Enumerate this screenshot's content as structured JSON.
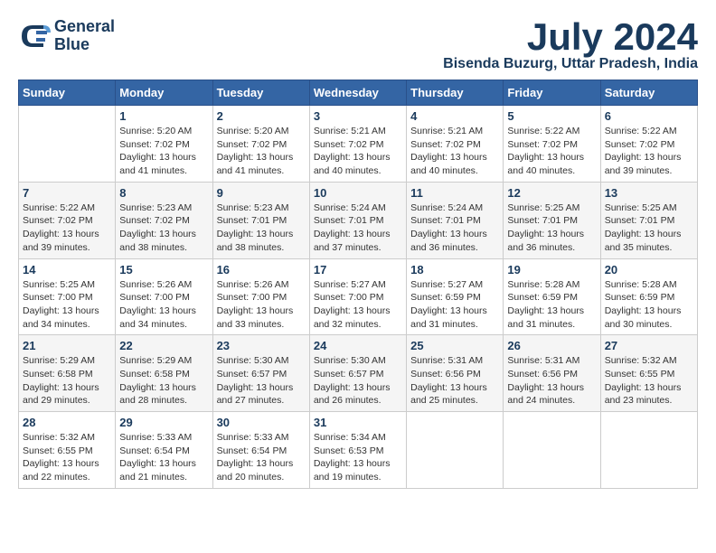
{
  "logo": {
    "line1": "General",
    "line2": "Blue"
  },
  "title": "July 2024",
  "location": "Bisenda Buzurg, Uttar Pradesh, India",
  "weekdays": [
    "Sunday",
    "Monday",
    "Tuesday",
    "Wednesday",
    "Thursday",
    "Friday",
    "Saturday"
  ],
  "weeks": [
    [
      {
        "day": "",
        "info": ""
      },
      {
        "day": "1",
        "info": "Sunrise: 5:20 AM\nSunset: 7:02 PM\nDaylight: 13 hours\nand 41 minutes."
      },
      {
        "day": "2",
        "info": "Sunrise: 5:20 AM\nSunset: 7:02 PM\nDaylight: 13 hours\nand 41 minutes."
      },
      {
        "day": "3",
        "info": "Sunrise: 5:21 AM\nSunset: 7:02 PM\nDaylight: 13 hours\nand 40 minutes."
      },
      {
        "day": "4",
        "info": "Sunrise: 5:21 AM\nSunset: 7:02 PM\nDaylight: 13 hours\nand 40 minutes."
      },
      {
        "day": "5",
        "info": "Sunrise: 5:22 AM\nSunset: 7:02 PM\nDaylight: 13 hours\nand 40 minutes."
      },
      {
        "day": "6",
        "info": "Sunrise: 5:22 AM\nSunset: 7:02 PM\nDaylight: 13 hours\nand 39 minutes."
      }
    ],
    [
      {
        "day": "7",
        "info": "Sunrise: 5:22 AM\nSunset: 7:02 PM\nDaylight: 13 hours\nand 39 minutes."
      },
      {
        "day": "8",
        "info": "Sunrise: 5:23 AM\nSunset: 7:02 PM\nDaylight: 13 hours\nand 38 minutes."
      },
      {
        "day": "9",
        "info": "Sunrise: 5:23 AM\nSunset: 7:01 PM\nDaylight: 13 hours\nand 38 minutes."
      },
      {
        "day": "10",
        "info": "Sunrise: 5:24 AM\nSunset: 7:01 PM\nDaylight: 13 hours\nand 37 minutes."
      },
      {
        "day": "11",
        "info": "Sunrise: 5:24 AM\nSunset: 7:01 PM\nDaylight: 13 hours\nand 36 minutes."
      },
      {
        "day": "12",
        "info": "Sunrise: 5:25 AM\nSunset: 7:01 PM\nDaylight: 13 hours\nand 36 minutes."
      },
      {
        "day": "13",
        "info": "Sunrise: 5:25 AM\nSunset: 7:01 PM\nDaylight: 13 hours\nand 35 minutes."
      }
    ],
    [
      {
        "day": "14",
        "info": "Sunrise: 5:25 AM\nSunset: 7:00 PM\nDaylight: 13 hours\nand 34 minutes."
      },
      {
        "day": "15",
        "info": "Sunrise: 5:26 AM\nSunset: 7:00 PM\nDaylight: 13 hours\nand 34 minutes."
      },
      {
        "day": "16",
        "info": "Sunrise: 5:26 AM\nSunset: 7:00 PM\nDaylight: 13 hours\nand 33 minutes."
      },
      {
        "day": "17",
        "info": "Sunrise: 5:27 AM\nSunset: 7:00 PM\nDaylight: 13 hours\nand 32 minutes."
      },
      {
        "day": "18",
        "info": "Sunrise: 5:27 AM\nSunset: 6:59 PM\nDaylight: 13 hours\nand 31 minutes."
      },
      {
        "day": "19",
        "info": "Sunrise: 5:28 AM\nSunset: 6:59 PM\nDaylight: 13 hours\nand 31 minutes."
      },
      {
        "day": "20",
        "info": "Sunrise: 5:28 AM\nSunset: 6:59 PM\nDaylight: 13 hours\nand 30 minutes."
      }
    ],
    [
      {
        "day": "21",
        "info": "Sunrise: 5:29 AM\nSunset: 6:58 PM\nDaylight: 13 hours\nand 29 minutes."
      },
      {
        "day": "22",
        "info": "Sunrise: 5:29 AM\nSunset: 6:58 PM\nDaylight: 13 hours\nand 28 minutes."
      },
      {
        "day": "23",
        "info": "Sunrise: 5:30 AM\nSunset: 6:57 PM\nDaylight: 13 hours\nand 27 minutes."
      },
      {
        "day": "24",
        "info": "Sunrise: 5:30 AM\nSunset: 6:57 PM\nDaylight: 13 hours\nand 26 minutes."
      },
      {
        "day": "25",
        "info": "Sunrise: 5:31 AM\nSunset: 6:56 PM\nDaylight: 13 hours\nand 25 minutes."
      },
      {
        "day": "26",
        "info": "Sunrise: 5:31 AM\nSunset: 6:56 PM\nDaylight: 13 hours\nand 24 minutes."
      },
      {
        "day": "27",
        "info": "Sunrise: 5:32 AM\nSunset: 6:55 PM\nDaylight: 13 hours\nand 23 minutes."
      }
    ],
    [
      {
        "day": "28",
        "info": "Sunrise: 5:32 AM\nSunset: 6:55 PM\nDaylight: 13 hours\nand 22 minutes."
      },
      {
        "day": "29",
        "info": "Sunrise: 5:33 AM\nSunset: 6:54 PM\nDaylight: 13 hours\nand 21 minutes."
      },
      {
        "day": "30",
        "info": "Sunrise: 5:33 AM\nSunset: 6:54 PM\nDaylight: 13 hours\nand 20 minutes."
      },
      {
        "day": "31",
        "info": "Sunrise: 5:34 AM\nSunset: 6:53 PM\nDaylight: 13 hours\nand 19 minutes."
      },
      {
        "day": "",
        "info": ""
      },
      {
        "day": "",
        "info": ""
      },
      {
        "day": "",
        "info": ""
      }
    ]
  ]
}
